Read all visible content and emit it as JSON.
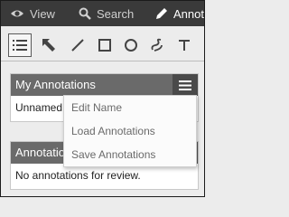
{
  "tabs": [
    {
      "label": "View",
      "icon": "eye-icon"
    },
    {
      "label": "Search",
      "icon": "search-icon"
    },
    {
      "label": "Annotate",
      "icon": "pencil-icon"
    }
  ],
  "tools": [
    "list-select-icon",
    "arrow-icon",
    "line-icon",
    "rectangle-icon",
    "circle-icon",
    "freehand-icon",
    "text-icon"
  ],
  "my_annotations": {
    "title": "My Annotations",
    "row_label": "Unnamed"
  },
  "annotations_review": {
    "title": "Annotations for Review",
    "empty_text": "No annotations for review."
  },
  "menu": {
    "items": [
      "Edit Name",
      "Load Annotations",
      "Save Annotations"
    ]
  },
  "colors": {
    "header": "#6a6a6a",
    "tabbar": "#3a3a3a"
  }
}
